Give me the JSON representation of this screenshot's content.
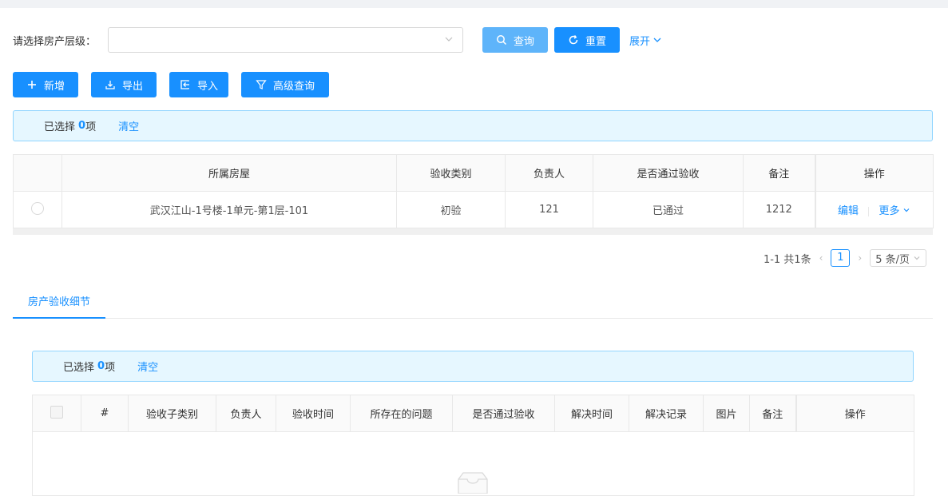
{
  "search": {
    "label": "请选择房产层级：",
    "query_label": "查询",
    "reset_label": "重置",
    "expand_label": "展开"
  },
  "toolbar": {
    "add_label": "新增",
    "export_label": "导出",
    "import_label": "导入",
    "advanced_label": "高级查询"
  },
  "selection": {
    "prefix": "已选择",
    "count": "0",
    "suffix": "项",
    "clear_label": "清空"
  },
  "main_table": {
    "columns": [
      "所属房屋",
      "验收类别",
      "负责人",
      "是否通过验收",
      "备注",
      "操作"
    ],
    "rows": [
      {
        "house": "武汉江山-1号楼-1单元-第1层-101",
        "category": "初验",
        "owner": "121",
        "passed": "已通过",
        "remark": "1212",
        "edit_label": "编辑",
        "more_label": "更多"
      }
    ]
  },
  "pagination": {
    "range_text": "1-1 共1条",
    "current_page": "1",
    "page_size": "5 条/页"
  },
  "detail_tabs": {
    "active_tab": "房产验收细节"
  },
  "detail_selection": {
    "prefix": "已选择",
    "count": "0",
    "suffix": "项",
    "clear_label": "清空"
  },
  "detail_table": {
    "columns": [
      "#",
      "验收子类别",
      "负责人",
      "验收时间",
      "所存在的问题",
      "是否通过验收",
      "解决时间",
      "解决记录",
      "图片",
      "备注",
      "操作"
    ]
  },
  "colors": {
    "primary": "#1890ff",
    "primary_light": "#5eb4fa",
    "alert_bg": "#e6f7ff",
    "alert_border": "#91d5ff"
  }
}
